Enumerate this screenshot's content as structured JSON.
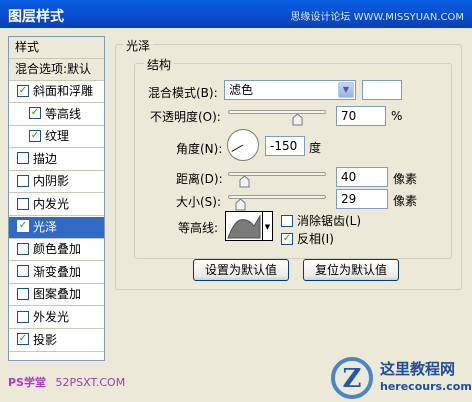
{
  "window": {
    "title": "图层样式",
    "watermark": "思缘设计论坛 WWW.MISSYUAN.COM"
  },
  "left_panel": {
    "header": "样式",
    "blend_default": "混合选项:默认",
    "items": [
      {
        "label": "斜面和浮雕",
        "checked": true,
        "indent": false,
        "selected": false
      },
      {
        "label": "等高线",
        "checked": true,
        "indent": true,
        "selected": false
      },
      {
        "label": "纹理",
        "checked": true,
        "indent": true,
        "selected": false
      },
      {
        "label": "描边",
        "checked": false,
        "indent": false,
        "selected": false
      },
      {
        "label": "内阴影",
        "checked": false,
        "indent": false,
        "selected": false
      },
      {
        "label": "内发光",
        "checked": false,
        "indent": false,
        "selected": false
      },
      {
        "label": "光泽",
        "checked": true,
        "indent": false,
        "selected": true
      },
      {
        "label": "颜色叠加",
        "checked": false,
        "indent": false,
        "selected": false
      },
      {
        "label": "渐变叠加",
        "checked": false,
        "indent": false,
        "selected": false
      },
      {
        "label": "图案叠加",
        "checked": false,
        "indent": false,
        "selected": false
      },
      {
        "label": "外发光",
        "checked": false,
        "indent": false,
        "selected": false
      },
      {
        "label": "投影",
        "checked": true,
        "indent": false,
        "selected": false
      }
    ]
  },
  "satin": {
    "title": "光泽",
    "structure_title": "结构",
    "blend_mode_label": "混合模式(B):",
    "blend_mode_value": "滤色",
    "blend_color": "#ffffff",
    "opacity_label": "不透明度(O):",
    "opacity_value": "70",
    "opacity_level": 70,
    "opacity_unit": "%",
    "angle_label": "角度(N):",
    "angle_value": "-150",
    "angle_deg": -150,
    "angle_unit": "度",
    "distance_label": "距离(D):",
    "distance_value": "40",
    "distance_level": 0.16,
    "distance_unit": "像素",
    "size_label": "大小(S):",
    "size_value": "29",
    "size_level": 0.12,
    "size_unit": "像素",
    "contour_label": "等高线:",
    "antialias_label": "消除锯齿(L)",
    "antialias_checked": false,
    "invert_label": "反相(I)",
    "invert_checked": true,
    "default_button": "设置为默认值",
    "reset_button": "复位为默认值"
  },
  "footer": {
    "left_logo": "PS学堂",
    "left_url": "52PSXT.COM",
    "brand_name": "这里教程网",
    "brand_url": "herecours.com"
  }
}
